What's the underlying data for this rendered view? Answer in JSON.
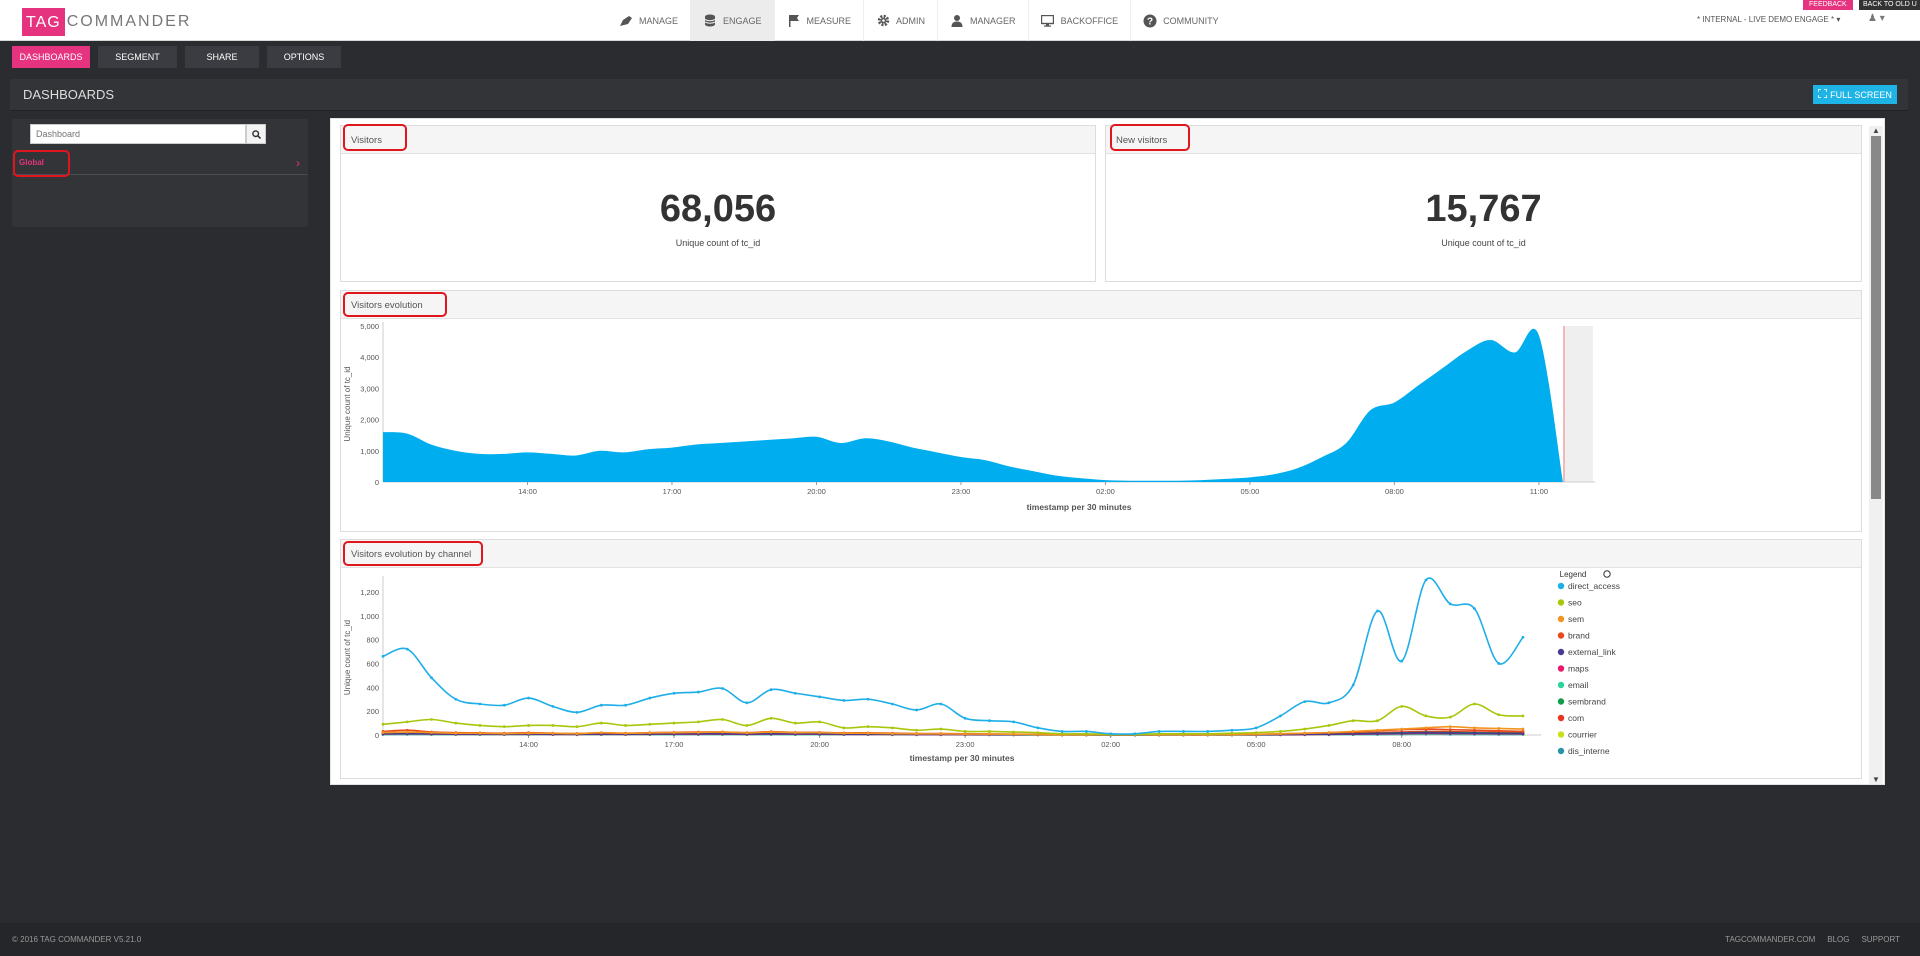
{
  "header": {
    "logo_left": "TAG",
    "logo_right": "COMMANDER",
    "nav": [
      {
        "label": "MANAGE",
        "icon": "rocket-icon"
      },
      {
        "label": "ENGAGE",
        "icon": "database-icon"
      },
      {
        "label": "MEASURE",
        "icon": "flag-icon"
      },
      {
        "label": "ADMIN",
        "icon": "gear-icon"
      },
      {
        "label": "MANAGER",
        "icon": "user-icon"
      },
      {
        "label": "BACKOFFICE",
        "icon": "monitor-icon"
      },
      {
        "label": "COMMUNITY",
        "icon": "question-circle-icon"
      }
    ],
    "environment": "* INTERNAL - LIVE DEMO ENGAGE *",
    "feedback": "FEEDBACK",
    "back_to_old": "BACK TO OLD U"
  },
  "subnav": [
    "DASHBOARDS",
    "SEGMENT",
    "SHARE",
    "OPTIONS"
  ],
  "page": {
    "title": "DASHBOARDS",
    "fullscreen": "FULL SCREEN"
  },
  "sidebar": {
    "search_placeholder": "Dashboard",
    "items": [
      {
        "label": "Global"
      }
    ]
  },
  "widgets": {
    "visitors": {
      "title": "Visitors",
      "value": "68,056",
      "subtitle": "Unique count of tc_id"
    },
    "new_visitors": {
      "title": "New visitors",
      "value": "15,767",
      "subtitle": "Unique count of tc_id"
    },
    "evolution": {
      "title": "Visitors evolution"
    },
    "by_channel": {
      "title": "Visitors evolution by channel"
    }
  },
  "chart_data": [
    {
      "type": "area",
      "ylabel": "Unique count of tc_id",
      "xlabel": "timestamp per 30 minutes",
      "ylim": [
        0,
        5000
      ],
      "yticks": [
        0,
        1000,
        2000,
        3000,
        4000,
        5000
      ],
      "ytick_labels": [
        "0",
        "1,000",
        "2,000",
        "3,000",
        "4,000",
        "5,000"
      ],
      "xtick_labels": [
        "14:00",
        "17:00",
        "20:00",
        "23:00",
        "02:00",
        "05:00",
        "08:00",
        "11:00"
      ],
      "xtick_index": [
        6,
        12,
        18,
        24,
        30,
        36,
        42,
        48
      ],
      "color": "#00aeef",
      "series": [
        {
          "values": [
            1600,
            1550,
            1200,
            1000,
            900,
            900,
            950,
            900,
            850,
            1000,
            950,
            1050,
            1100,
            1200,
            1250,
            1300,
            1350,
            1400,
            1450,
            1250,
            1400,
            1300,
            1100,
            950,
            800,
            700,
            500,
            350,
            200,
            120,
            60,
            40,
            40,
            40,
            60,
            100,
            150,
            250,
            450,
            800,
            1250,
            2300,
            2550,
            3100,
            3650,
            4200,
            4550,
            4150,
            4700,
            0
          ]
        }
      ]
    },
    {
      "type": "line",
      "ylabel": "Unique count of tc_id",
      "xlabel": "timestamp per 30 minutes",
      "ylim": [
        0,
        1300
      ],
      "yticks": [
        0,
        200,
        400,
        600,
        800,
        1000,
        1200
      ],
      "ytick_labels": [
        "0",
        "200",
        "400",
        "600",
        "800",
        "1,000",
        "1,200"
      ],
      "xtick_labels": [
        "14:00",
        "17:00",
        "20:00",
        "23:00",
        "02:00",
        "05:00",
        "08:00"
      ],
      "xtick_index": [
        6,
        12,
        18,
        24,
        30,
        36,
        42
      ],
      "legend_title": "Legend",
      "series": [
        {
          "name": "direct_access",
          "color": "#1eaee8",
          "values": [
            660,
            720,
            480,
            300,
            260,
            250,
            310,
            240,
            190,
            250,
            250,
            310,
            350,
            360,
            390,
            270,
            380,
            350,
            320,
            290,
            300,
            260,
            210,
            260,
            140,
            120,
            110,
            60,
            30,
            30,
            10,
            10,
            30,
            30,
            30,
            40,
            60,
            160,
            280,
            270,
            420,
            1040,
            620,
            1300,
            1100,
            1060,
            600,
            820
          ]
        },
        {
          "name": "seo",
          "color": "#a8c60a",
          "values": [
            90,
            110,
            130,
            100,
            80,
            70,
            80,
            80,
            70,
            100,
            80,
            90,
            100,
            110,
            130,
            80,
            140,
            100,
            110,
            60,
            70,
            60,
            40,
            50,
            30,
            30,
            25,
            20,
            10,
            10,
            5,
            5,
            10,
            10,
            10,
            15,
            20,
            30,
            50,
            80,
            120,
            120,
            240,
            160,
            150,
            260,
            170,
            160
          ]
        },
        {
          "name": "sem",
          "color": "#f29520",
          "values": [
            20,
            25,
            20,
            15,
            15,
            12,
            15,
            15,
            12,
            20,
            15,
            18,
            20,
            22,
            25,
            18,
            25,
            20,
            20,
            15,
            15,
            12,
            10,
            10,
            8,
            8,
            6,
            5,
            3,
            3,
            2,
            2,
            3,
            3,
            3,
            4,
            6,
            10,
            15,
            20,
            30,
            40,
            50,
            60,
            70,
            60,
            55,
            50
          ]
        },
        {
          "name": "brand",
          "color": "#e84a1b",
          "values": [
            30,
            40,
            25,
            20,
            18,
            15,
            20,
            15,
            12,
            18,
            15,
            20,
            22,
            25,
            25,
            20,
            28,
            22,
            22,
            18,
            18,
            15,
            12,
            12,
            10,
            9,
            7,
            6,
            4,
            3,
            2,
            2,
            3,
            3,
            3,
            4,
            6,
            10,
            15,
            20,
            25,
            35,
            45,
            50,
            45,
            40,
            35,
            30
          ]
        },
        {
          "name": "external_link",
          "color": "#4a3a8e",
          "values": [
            10,
            12,
            10,
            8,
            8,
            7,
            8,
            7,
            6,
            8,
            7,
            8,
            9,
            10,
            10,
            8,
            10,
            9,
            9,
            7,
            7,
            6,
            5,
            5,
            4,
            4,
            3,
            3,
            2,
            2,
            1,
            1,
            2,
            2,
            2,
            2,
            3,
            4,
            5,
            7,
            9,
            12,
            15,
            18,
            16,
            15,
            13,
            12
          ]
        },
        {
          "name": "maps",
          "color": "#e8196e",
          "values": [
            8,
            10,
            8,
            6,
            6,
            5,
            6,
            5,
            5,
            6,
            5,
            6,
            7,
            7,
            8,
            6,
            8,
            7,
            7,
            5,
            5,
            5,
            4,
            4,
            3,
            3,
            2,
            2,
            1,
            1,
            1,
            1,
            1,
            1,
            1,
            2,
            2,
            3,
            4,
            5,
            7,
            9,
            11,
            13,
            12,
            11,
            10,
            9
          ]
        },
        {
          "name": "email",
          "color": "#2bd49a",
          "values": [
            5,
            6,
            5,
            4,
            4,
            3,
            4,
            3,
            3,
            4,
            3,
            4,
            4,
            5,
            5,
            4,
            5,
            4,
            4,
            3,
            3,
            3,
            2,
            2,
            2,
            2,
            1,
            1,
            1,
            1,
            0,
            0,
            1,
            1,
            1,
            1,
            1,
            2,
            3,
            3,
            4,
            5,
            6,
            7,
            7,
            6,
            6,
            5
          ]
        },
        {
          "name": "sembrand",
          "color": "#129b4a",
          "values": [
            12,
            14,
            12,
            10,
            9,
            8,
            9,
            8,
            7,
            9,
            8,
            9,
            10,
            11,
            12,
            9,
            12,
            10,
            10,
            8,
            8,
            7,
            6,
            6,
            5,
            4,
            3,
            3,
            2,
            2,
            1,
            1,
            2,
            2,
            2,
            2,
            3,
            4,
            6,
            8,
            10,
            14,
            18,
            22,
            20,
            18,
            16,
            14
          ]
        },
        {
          "name": "com",
          "color": "#e8341f",
          "values": [
            15,
            18,
            15,
            12,
            11,
            10,
            11,
            10,
            9,
            11,
            10,
            11,
            12,
            13,
            14,
            11,
            14,
            12,
            12,
            10,
            10,
            9,
            8,
            8,
            6,
            5,
            4,
            4,
            2,
            2,
            1,
            1,
            2,
            2,
            2,
            3,
            4,
            6,
            8,
            10,
            14,
            20,
            25,
            30,
            28,
            25,
            22,
            20
          ]
        },
        {
          "name": "courrier",
          "color": "#c8e01a",
          "values": [
            6,
            7,
            6,
            5,
            5,
            4,
            5,
            4,
            4,
            5,
            4,
            5,
            5,
            6,
            6,
            5,
            6,
            5,
            5,
            4,
            4,
            4,
            3,
            3,
            2,
            2,
            2,
            1,
            1,
            1,
            0,
            0,
            1,
            1,
            1,
            1,
            2,
            2,
            3,
            4,
            5,
            7,
            9,
            10,
            9,
            8,
            7,
            6
          ]
        },
        {
          "name": "dis_interne",
          "color": "#2a93a8",
          "values": [
            4,
            5,
            4,
            3,
            3,
            3,
            3,
            3,
            2,
            3,
            3,
            3,
            3,
            4,
            4,
            3,
            4,
            3,
            3,
            3,
            3,
            2,
            2,
            2,
            2,
            1,
            1,
            1,
            1,
            0,
            0,
            0,
            0,
            0,
            1,
            1,
            1,
            1,
            2,
            2,
            3,
            4,
            5,
            6,
            5,
            5,
            4,
            4
          ]
        }
      ]
    }
  ],
  "footer": {
    "copyright": "© 2016 TAG COMMANDER V5.21.0",
    "links": [
      "TAGCOMMANDER.COM",
      "BLOG",
      "SUPPORT"
    ]
  }
}
